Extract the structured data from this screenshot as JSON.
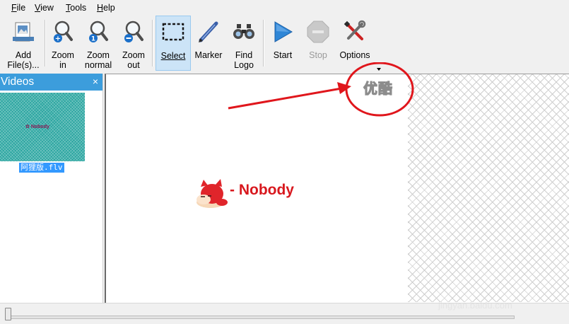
{
  "menu": {
    "file": {
      "ul": "F",
      "rest": "ile"
    },
    "view": {
      "ul": "V",
      "rest": "iew"
    },
    "tools": {
      "ul": "T",
      "rest": "ools"
    },
    "help": {
      "ul": "H",
      "rest": "elp"
    }
  },
  "toolbar": {
    "add_files": "Add\nFile(s)...",
    "zoom_in": "Zoom\nin",
    "zoom_normal": "Zoom\nnormal",
    "zoom_out": "Zoom\nout",
    "select": "Select",
    "marker": "Marker",
    "find_logo": "Find\nLogo",
    "start": "Start",
    "stop": "Stop",
    "options": "Options"
  },
  "videos_panel": {
    "title": "Videos",
    "close": "×",
    "thumbnail_logo": "Nobody",
    "items": [
      {
        "caption": "阿狸版.flv"
      }
    ]
  },
  "video": {
    "logo_text": "- Nobody",
    "watermark_text": "优酷"
  },
  "footer": {
    "watermark": "jingyan.baidu.com"
  },
  "colors": {
    "panel_header": "#3c9ddc",
    "selected_tool": "#cce4f7",
    "annotation_red": "#e0161c",
    "nobody_red": "#d8181e"
  }
}
